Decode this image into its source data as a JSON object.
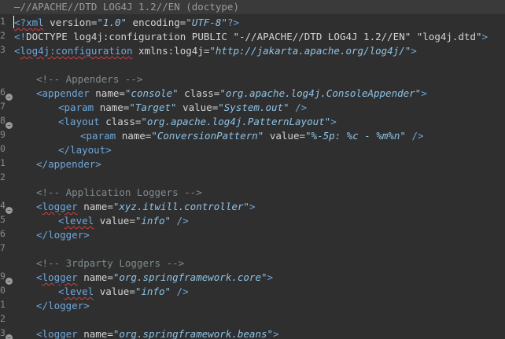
{
  "header": {
    "text": "—//APACHE//DTD LOG4J 1.2//EN (doctype)"
  },
  "gutter": {
    "line_numbers": [
      "1",
      "2",
      "3",
      "",
      "",
      "6",
      "7",
      "8",
      "9",
      "0",
      "1",
      "2",
      "",
      "4",
      "5",
      "6",
      "7",
      "",
      "9",
      "0",
      "1",
      "2",
      "3",
      "4"
    ]
  },
  "code": {
    "l1": {
      "open": "<?",
      "name": "xml",
      "a1": "version=",
      "v1": "\"1.0\"",
      "a2": " encoding=",
      "v2": "\"UTF-8\"",
      "close": "?>"
    },
    "l2": {
      "open": "<!",
      "name": "DOCTYPE",
      "rest": " log4j:configuration ",
      "kw": "PUBLIC",
      "s1": " \"-//APACHE//DTD LOG4J 1.2//EN\" ",
      "s2": "\"log4j.dtd\"",
      "close": ">"
    },
    "l3": {
      "open": "<",
      "name": "log4j:configuration",
      "a1": " xmlns:log4j=",
      "v1": "\"http://jakarta.apache.org/log4j/\"",
      "close": ">"
    },
    "c_appenders": "<!-- Appenders -->",
    "appender": {
      "open": "<",
      "name": "appender",
      "a1": " name=",
      "v1": "\"console\"",
      "a2": " class=",
      "v2": "\"org.apache.log4j.ConsoleAppender\"",
      "close": ">"
    },
    "param1": {
      "open": "<",
      "name": "param",
      "a1": " name=",
      "v1": "\"Target\"",
      "a2": " value=",
      "v2": "\"System.out\"",
      "close": " />"
    },
    "layout": {
      "open": "<",
      "name": "layout",
      "a1": " class=",
      "v1": "\"org.apache.log4j.PatternLayout\"",
      "close": ">"
    },
    "param2": {
      "open": "<",
      "name": "param",
      "a1": " name=",
      "v1": "\"ConversionPattern\"",
      "a2": " value=",
      "v2": "\"%-5p: %c - %m%n\"",
      "close": " />"
    },
    "layout_end": {
      "open": "</",
      "name": "layout",
      "close": ">"
    },
    "appender_end": {
      "open": "</",
      "name": "appender",
      "close": ">"
    },
    "c_app_loggers": "<!-- Application Loggers -->",
    "logger1": {
      "open": "<",
      "name": "logger",
      "a1": " name=",
      "v1": "\"xyz.itwill.controller\"",
      "close": ">"
    },
    "level1": {
      "open": "<",
      "name": "level",
      "a1": " value=",
      "v1": "\"info\"",
      "close": " />"
    },
    "logger1_end": {
      "open": "</",
      "name": "logger",
      "close": ">"
    },
    "c_3rdparty": "<!-- 3rdparty Loggers -->",
    "logger2": {
      "open": "<",
      "name": "logger",
      "a1": " name=",
      "v1": "\"org.springframework.core\"",
      "close": ">"
    },
    "level2": {
      "open": "<",
      "name": "level",
      "a1": " value=",
      "v1": "\"info\"",
      "close": " />"
    },
    "logger2_end": {
      "open": "</",
      "name": "logger",
      "close": ">"
    },
    "logger3": {
      "open": "<",
      "name": "logger",
      "a1": " name=",
      "v1": "\"org.springframework.beans\"",
      "close": ">"
    }
  },
  "colors": {
    "background": "#2f2f2f",
    "tag": "#6fa8dc",
    "value": "#8ec3e6",
    "comment": "#7f8b8f",
    "error_underline": "#d04040"
  }
}
